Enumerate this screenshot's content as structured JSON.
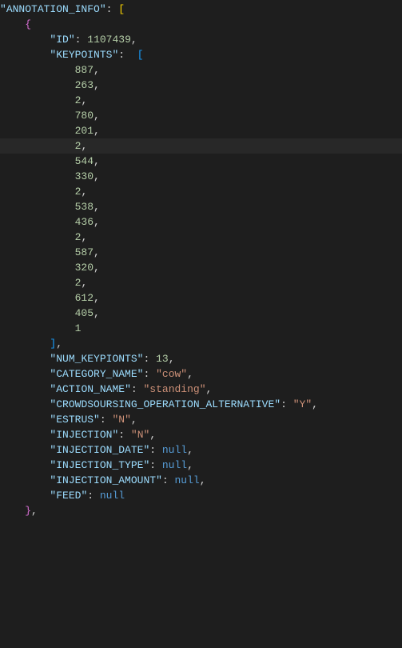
{
  "root_key": "ANNOTATION_INFO",
  "obj": {
    "id_key": "ID",
    "id_val": "1107439",
    "keypoints_key": "KEYPOINTS",
    "keypoints": [
      "887",
      "263",
      "2",
      "780",
      "201",
      "2",
      "544",
      "330",
      "2",
      "538",
      "436",
      "2",
      "587",
      "320",
      "2",
      "612",
      "405",
      "1"
    ],
    "numkp_key": "NUM_KEYPIONTS",
    "numkp_val": "13",
    "cat_key": "CATEGORY_NAME",
    "cat_val": "cow",
    "act_key": "ACTION_NAME",
    "act_val": "standing",
    "crowd_key": "CROWDSOURSING_OPERATION_ALTERNATIVE",
    "crowd_val": "Y",
    "estrus_key": "ESTRUS",
    "estrus_val": "N",
    "inj_key": "INJECTION",
    "inj_val": "N",
    "injdate_key": "INJECTION_DATE",
    "injdate_val": "null",
    "injtype_key": "INJECTION_TYPE",
    "injtype_val": "null",
    "injamt_key": "INJECTION_AMOUNT",
    "injamt_val": "null",
    "feed_key": "FEED",
    "feed_val": "null"
  },
  "ind": {
    "i0": "",
    "i1": "    ",
    "i2": "        ",
    "i3": "            "
  }
}
